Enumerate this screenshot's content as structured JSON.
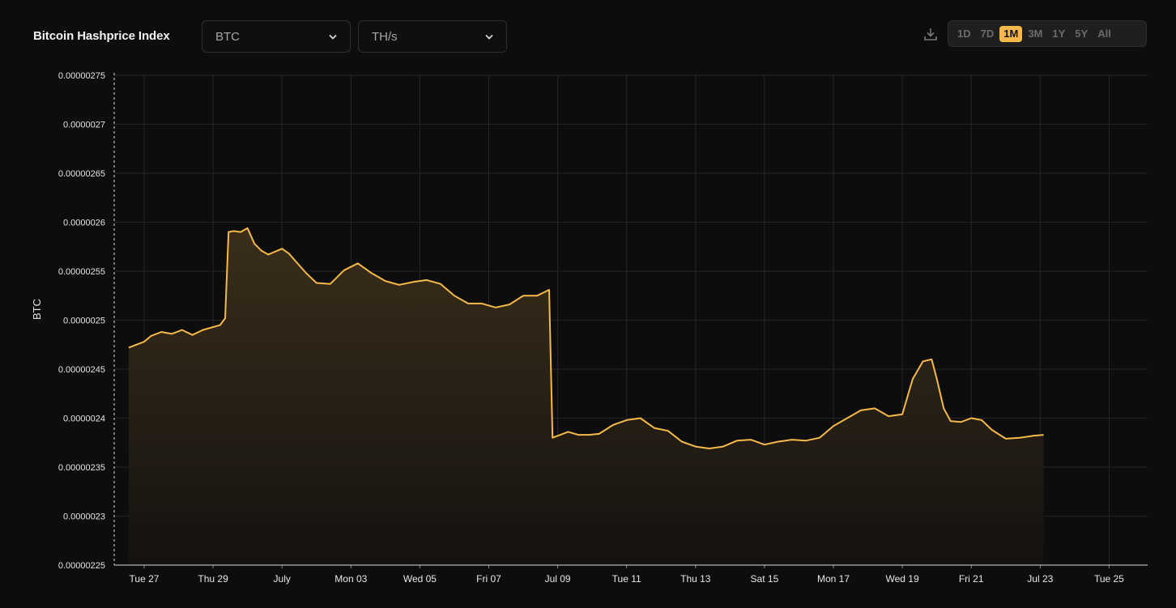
{
  "header": {
    "title": "Bitcoin Hashprice Index",
    "currency_select": {
      "value": "BTC",
      "icon": "chevron-down-icon"
    },
    "unit_select": {
      "value": "TH/s",
      "icon": "chevron-down-icon"
    },
    "download_icon": "download-icon"
  },
  "ranges": [
    {
      "label": "1D",
      "active": false
    },
    {
      "label": "7D",
      "active": false
    },
    {
      "label": "1M",
      "active": true
    },
    {
      "label": "3M",
      "active": false
    },
    {
      "label": "1Y",
      "active": false
    },
    {
      "label": "5Y",
      "active": false
    },
    {
      "label": "All",
      "active": false
    }
  ],
  "colors": {
    "background": "#0d0d0d",
    "line": "#f5b94a",
    "area_top": "#3a2e1a",
    "grid": "#262626",
    "active_range": "#f5b94a"
  },
  "chart_data": {
    "type": "area",
    "ylabel": "BTC",
    "ylim": [
      2.25e-06,
      2.75e-06
    ],
    "yticks": [
      "0.00000275",
      "0.0000027",
      "0.00000265",
      "0.0000026",
      "0.00000255",
      "0.0000025",
      "0.00000245",
      "0.0000024",
      "0.00000235",
      "0.0000023",
      "0.00000225"
    ],
    "xticks": [
      "Tue 27",
      "Thu 29",
      "July",
      "Mon 03",
      "Wed 05",
      "Fri 07",
      "Jul 09",
      "Tue 11",
      "Thu 13",
      "Sat 15",
      "Mon 17",
      "Wed 19",
      "Fri 21",
      "Jul 23",
      "Tue 25"
    ],
    "x": [
      -0.45,
      0,
      0.2,
      0.5,
      0.8,
      1.1,
      1.4,
      1.7,
      2.0,
      2.2,
      2.35,
      2.45,
      2.6,
      2.8,
      3.0,
      3.2,
      3.4,
      3.6,
      3.8,
      4.0,
      4.2,
      4.4,
      4.7,
      5.0,
      5.4,
      5.8,
      6.2,
      6.6,
      7.0,
      7.4,
      7.8,
      8.2,
      8.6,
      9.0,
      9.4,
      9.8,
      10.2,
      10.6,
      11.0,
      11.4,
      11.75,
      11.85,
      12.0,
      12.3,
      12.6,
      12.9,
      13.2,
      13.6,
      14.0,
      14.4,
      14.8,
      15.2,
      15.6,
      16.0,
      16.4,
      16.8,
      17.2,
      17.6,
      18.0,
      18.4,
      18.8,
      19.2,
      19.6,
      20.0,
      20.4,
      20.8,
      21.2,
      21.6,
      22.0,
      22.3,
      22.6,
      22.85,
      23.0,
      23.2,
      23.4,
      23.7,
      24.0,
      24.3,
      24.6,
      25.0,
      25.4,
      25.8,
      26.1
    ],
    "y": [
      2.472e-06,
      2.478e-06,
      2.484e-06,
      2.488e-06,
      2.486e-06,
      2.49e-06,
      2.485e-06,
      2.49e-06,
      2.493e-06,
      2.495e-06,
      2.502e-06,
      2.59e-06,
      2.591e-06,
      2.59e-06,
      2.594e-06,
      2.578e-06,
      2.571e-06,
      2.567e-06,
      2.57e-06,
      2.573e-06,
      2.568e-06,
      2.56e-06,
      2.548e-06,
      2.538e-06,
      2.537e-06,
      2.551e-06,
      2.558e-06,
      2.548e-06,
      2.54e-06,
      2.536e-06,
      2.539e-06,
      2.541e-06,
      2.537e-06,
      2.525e-06,
      2.517e-06,
      2.517e-06,
      2.513e-06,
      2.516e-06,
      2.525e-06,
      2.525e-06,
      2.531e-06,
      2.38e-06,
      2.382e-06,
      2.386e-06,
      2.383e-06,
      2.383e-06,
      2.384e-06,
      2.393e-06,
      2.398e-06,
      2.4e-06,
      2.39e-06,
      2.387e-06,
      2.376e-06,
      2.371e-06,
      2.369e-06,
      2.371e-06,
      2.377e-06,
      2.378e-06,
      2.373e-06,
      2.376e-06,
      2.378e-06,
      2.377e-06,
      2.38e-06,
      2.392e-06,
      2.4e-06,
      2.408e-06,
      2.41e-06,
      2.402e-06,
      2.404e-06,
      2.44e-06,
      2.458e-06,
      2.46e-06,
      2.44e-06,
      2.41e-06,
      2.397e-06,
      2.396e-06,
      2.4e-06,
      2.398e-06,
      2.388e-06,
      2.379e-06,
      2.38e-06,
      2.382e-06,
      2.383e-06
    ]
  }
}
